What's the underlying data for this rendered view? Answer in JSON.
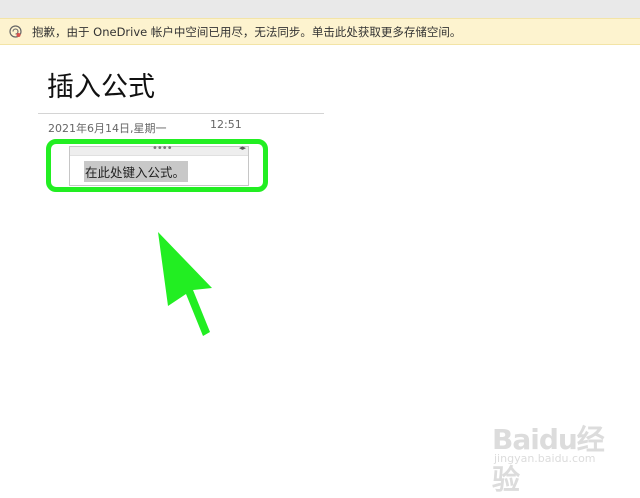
{
  "notice": {
    "text": "抱歉，由于 OneDrive 帐户中空间已用尽，无法同步。单击此处获取更多存储空间。",
    "icon": "sync-error-icon"
  },
  "page": {
    "title": "插入公式",
    "date": "2021年6月14日,星期一",
    "time": "12:51"
  },
  "equation": {
    "placeholder": "在此处键入公式。",
    "grip": "••••",
    "resize": "◂▸"
  },
  "annotation": {
    "highlight_color": "#22ee22",
    "arrow_color": "#22ee22"
  },
  "watermark": {
    "logo": "Baidu经验",
    "url": "jingyan.baidu.com"
  }
}
